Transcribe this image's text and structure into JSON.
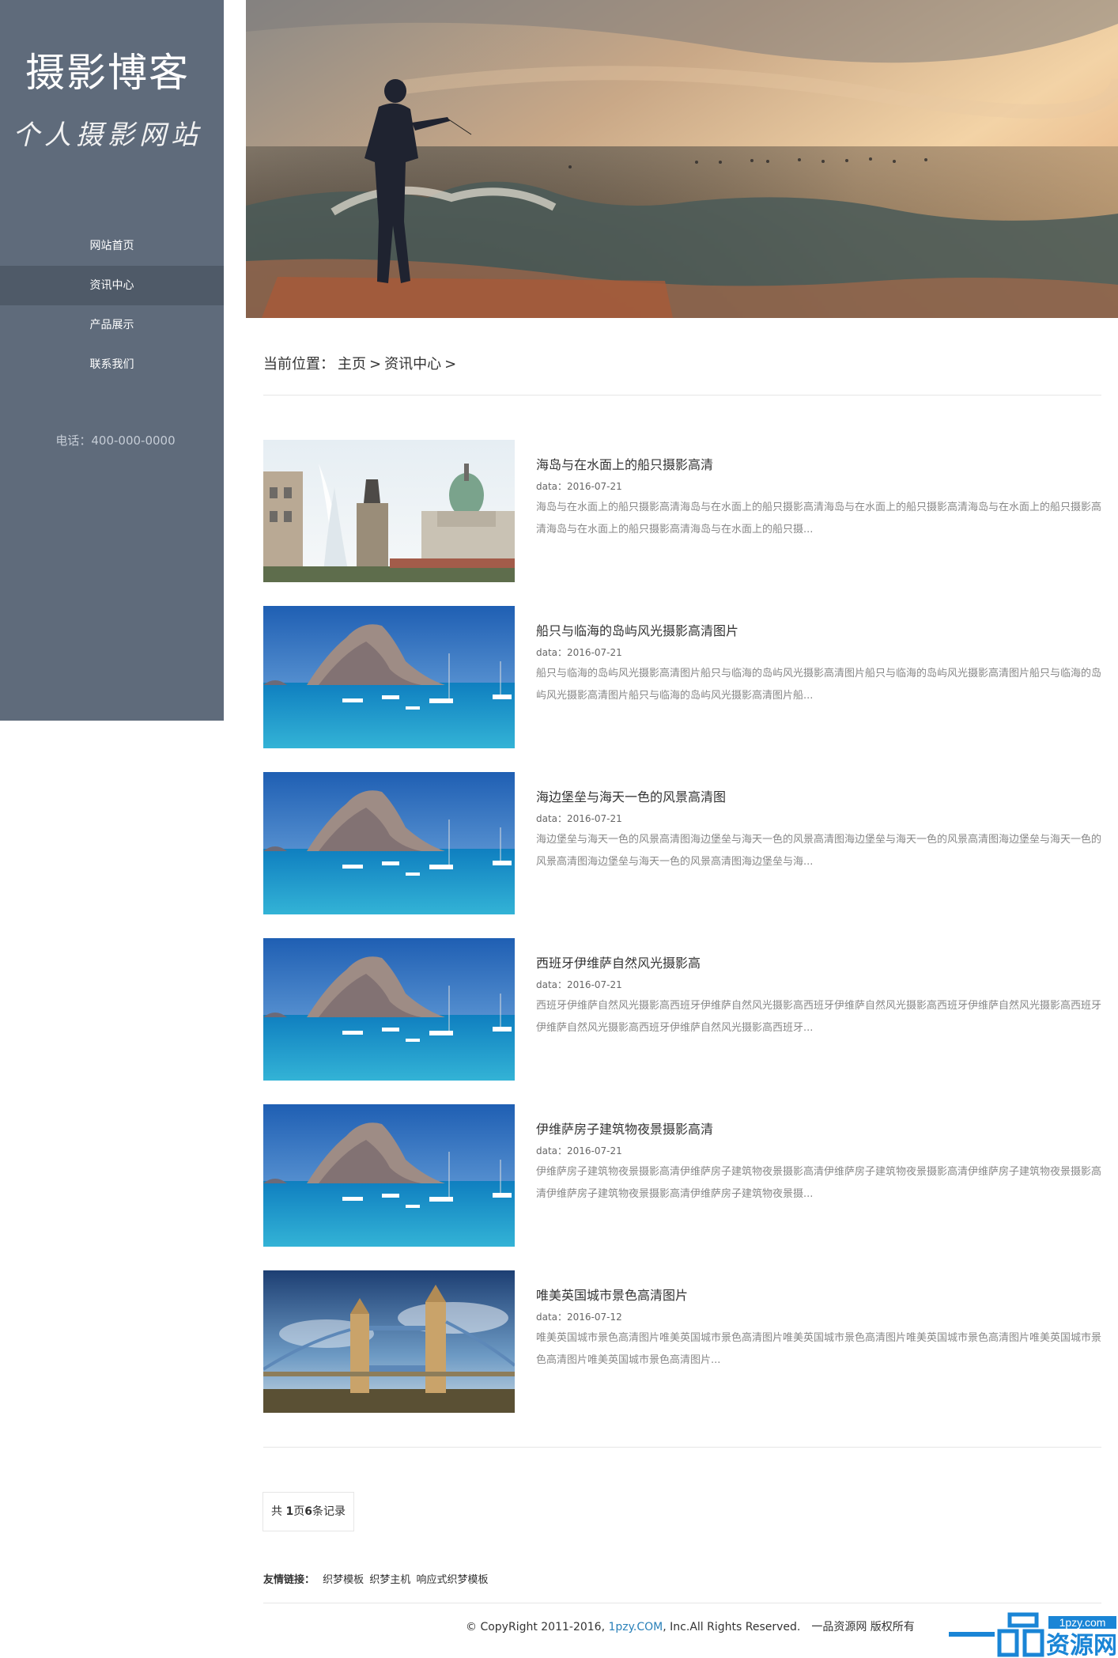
{
  "sidebar": {
    "site_title": "摄影博客",
    "site_subtitle": "个人摄影网站",
    "nav": [
      {
        "label": "网站首页",
        "active": false
      },
      {
        "label": "资讯中心",
        "active": true
      },
      {
        "label": "产品展示",
        "active": false
      },
      {
        "label": "联系我们",
        "active": false
      }
    ],
    "phone": "电话：400-000-0000"
  },
  "breadcrumb": {
    "prefix": "当前位置：",
    "home": "主页",
    "sep1": ">",
    "current": "资讯中心",
    "sep2": ">"
  },
  "articles": [
    {
      "title": "海岛与在水面上的船只摄影高清",
      "date": "data：2016-07-21",
      "desc": "海岛与在水面上的船只摄影高清海岛与在水面上的船只摄影高清海岛与在水面上的船只摄影高清海岛与在水面上的船只摄影高清海岛与在水面上的船只摄影高清海岛与在水面上的船只摄...",
      "image": "city-fountain-palace"
    },
    {
      "title": "船只与临海的岛屿风光摄影高清图片",
      "date": "data：2016-07-21",
      "desc": "船只与临海的岛屿风光摄影高清图片船只与临海的岛屿风光摄影高清图片船只与临海的岛屿风光摄影高清图片船只与临海的岛屿风光摄影高清图片船只与临海的岛屿风光摄影高清图片船...",
      "image": "island-boats"
    },
    {
      "title": "海边堡垒与海天一色的风景高清图",
      "date": "data：2016-07-21",
      "desc": "海边堡垒与海天一色的风景高清图海边堡垒与海天一色的风景高清图海边堡垒与海天一色的风景高清图海边堡垒与海天一色的风景高清图海边堡垒与海天一色的风景高清图海边堡垒与海...",
      "image": "island-boats"
    },
    {
      "title": "西班牙伊维萨自然风光摄影高",
      "date": "data：2016-07-21",
      "desc": "西班牙伊维萨自然风光摄影高西班牙伊维萨自然风光摄影高西班牙伊维萨自然风光摄影高西班牙伊维萨自然风光摄影高西班牙伊维萨自然风光摄影高西班牙伊维萨自然风光摄影高西班牙...",
      "image": "island-boats"
    },
    {
      "title": "伊维萨房子建筑物夜景摄影高清",
      "date": "data：2016-07-21",
      "desc": "伊维萨房子建筑物夜景摄影高清伊维萨房子建筑物夜景摄影高清伊维萨房子建筑物夜景摄影高清伊维萨房子建筑物夜景摄影高清伊维萨房子建筑物夜景摄影高清伊维萨房子建筑物夜景摄...",
      "image": "island-boats"
    },
    {
      "title": "唯美英国城市景色高清图片",
      "date": "data：2016-07-12",
      "desc": "唯美英国城市景色高清图片唯美英国城市景色高清图片唯美英国城市景色高清图片唯美英国城市景色高清图片唯美英国城市景色高清图片唯美英国城市景色高清图片...",
      "image": "tower-bridge"
    }
  ],
  "pager": {
    "prefix": "共 ",
    "pages": "1",
    "mid": "页",
    "records": "6",
    "suffix": "条记录"
  },
  "links": {
    "label": "友情链接：",
    "items": [
      "织梦模板",
      "织梦主机",
      "响应式织梦模板"
    ]
  },
  "footer": {
    "copy": "© CopyRight 2011-2016, ",
    "site": "1pzy.COM",
    "rights": ", Inc.All Rights Reserved.",
    "owner": "一品资源网 版权所有"
  },
  "brand": {
    "domain": "1pzy.com",
    "name": "资源网",
    "mark": "一品"
  },
  "colors": {
    "sidebar_bg": "#5f6b7b",
    "nav_active": "#4f5a68",
    "link_blue": "#2980b9",
    "brand_blue": "#1a85d6"
  }
}
